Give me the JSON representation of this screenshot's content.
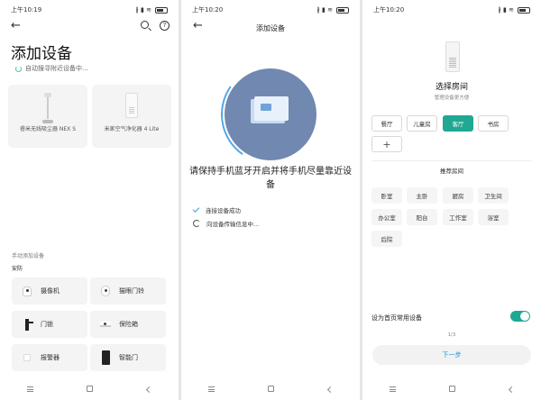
{
  "screen1": {
    "status_time": "上午10:19",
    "status_icons": "∦ ▮ ≋",
    "title": "添加设备",
    "scan_text": "自动搜寻附近设备中...",
    "found_devices": [
      {
        "name": "睿米无线吸尘器 NEX S",
        "icon": "vacuum-icon"
      },
      {
        "name": "米家空气净化器 4 Lite",
        "icon": "air-purifier-icon"
      }
    ],
    "manual_title": "手动添加设备",
    "category_label": "安防",
    "manual_devices": [
      {
        "name": "摄像机",
        "icon": "camera-icon"
      },
      {
        "name": "猫眼门铃",
        "icon": "doorbell-icon"
      },
      {
        "name": "门锁",
        "icon": "door-lock-icon"
      },
      {
        "name": "保险箱",
        "icon": "safe-icon"
      },
      {
        "name": "报警器",
        "icon": "alarm-icon"
      },
      {
        "name": "智能门",
        "icon": "smart-door-icon"
      }
    ]
  },
  "screen2": {
    "status_time": "上午10:20",
    "status_icons": "∦ ▮ ≋",
    "title": "添加设备",
    "instruction": "请保持手机蓝牙开启并将手机尽量靠近设备",
    "steps": [
      {
        "text": "连接设备成功",
        "state": "done"
      },
      {
        "text": "向设备传输信息中...",
        "state": "loading"
      }
    ],
    "accent_color": "#7189b1"
  },
  "screen3": {
    "status_time": "上午10:20",
    "status_icons": "∦ ▮ ≋",
    "title": "选择房间",
    "subtitle": "管理设备更方便",
    "rooms": [
      "餐厅",
      "儿童房",
      "客厅",
      "书房"
    ],
    "selected_room": "客厅",
    "add_label": "+",
    "recommended_title": "推荐房间",
    "recommended": [
      "卧室",
      "主卧",
      "厨房",
      "卫生间",
      "办公室",
      "阳台",
      "工作室",
      "浴室",
      "后院"
    ],
    "toggle_label": "设为首页常用设备",
    "toggle_on": true,
    "pager": "1/3",
    "next_label": "下一步",
    "accent_color": "#1fa893"
  }
}
